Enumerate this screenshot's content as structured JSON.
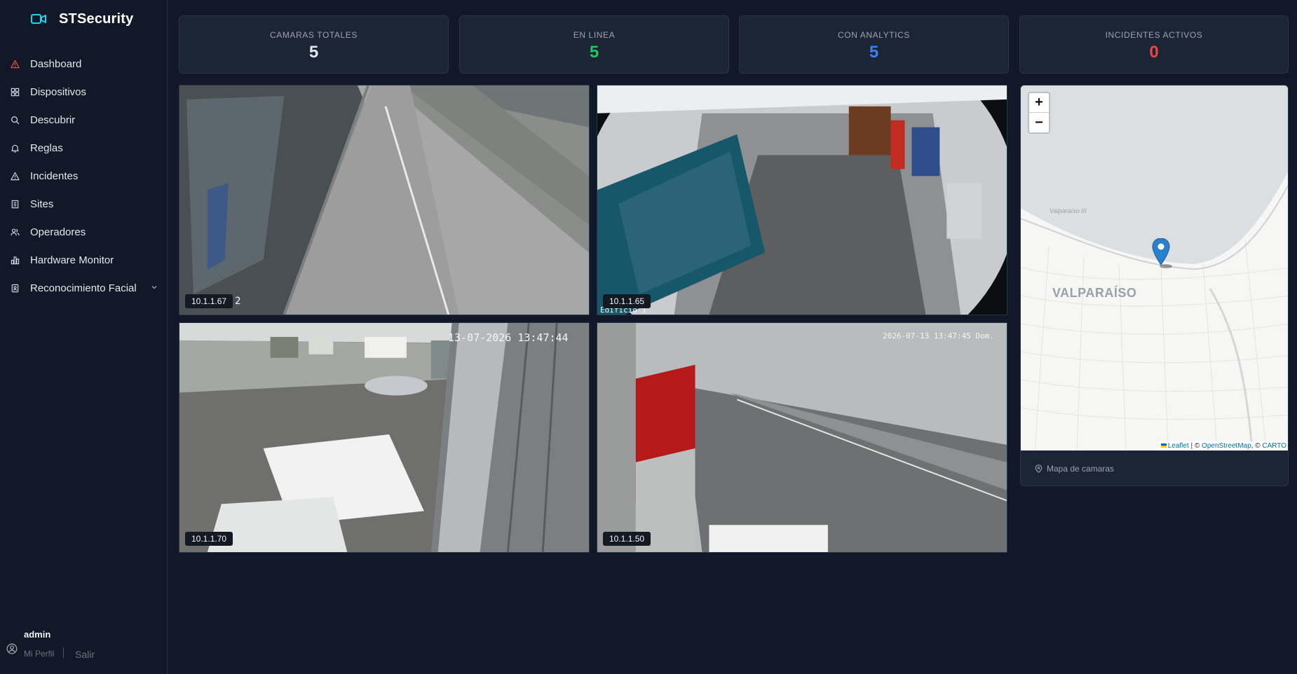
{
  "brand": {
    "name": "STSecurity",
    "accent": "#22d3ee"
  },
  "nav": [
    {
      "label": "Dashboard",
      "icon": "alert-triangle-icon",
      "active": true
    },
    {
      "label": "Dispositivos",
      "icon": "grid-icon"
    },
    {
      "label": "Descubrir",
      "icon": "search-icon"
    },
    {
      "label": "Reglas",
      "icon": "bell-icon"
    },
    {
      "label": "Incidentes",
      "icon": "alert-triangle-icon"
    },
    {
      "label": "Sites",
      "icon": "building-icon"
    },
    {
      "label": "Operadores",
      "icon": "users-icon"
    },
    {
      "label": "Hardware Monitor",
      "icon": "bar-chart-icon"
    },
    {
      "label": "Reconocimiento Facial",
      "icon": "id-badge-icon",
      "expandable": true
    }
  ],
  "user": {
    "name": "admin",
    "profile_link": "Mi Perfil",
    "logout_link": "Salir"
  },
  "stats": [
    {
      "label": "CAMARAS TOTALES",
      "value": "5",
      "color": "#e5e7eb"
    },
    {
      "label": "EN LINEA",
      "value": "5",
      "color": "#22c55e"
    },
    {
      "label": "CON ANALYTICS",
      "value": "5",
      "color": "#3b82f6"
    },
    {
      "label": "INCIDENTES ACTIVOS",
      "value": "0",
      "color": "#ef4444"
    }
  ],
  "cameras": [
    {
      "ip": "10.1.1.67",
      "osd": "2"
    },
    {
      "ip": "10.1.1.65",
      "osd": "Edificio 1"
    },
    {
      "ip": "10.1.1.70",
      "osd": "13-07-2026 13:47:44"
    },
    {
      "ip": "10.1.1.50",
      "osd": "2026-07-13 13:47:45 Dom."
    }
  ],
  "map": {
    "zoom_in": "+",
    "zoom_out": "−",
    "city_label": "VALPARAÍSO",
    "place_label": "Valparaíso III",
    "attribution": {
      "leaflet": "Leaflet",
      "sep1": " | © ",
      "osm": "OpenStreetMap",
      "sep2": ", © ",
      "carto": "CARTO"
    },
    "footer_label": "Mapa de camaras",
    "marker_color": "#2a81cb"
  }
}
